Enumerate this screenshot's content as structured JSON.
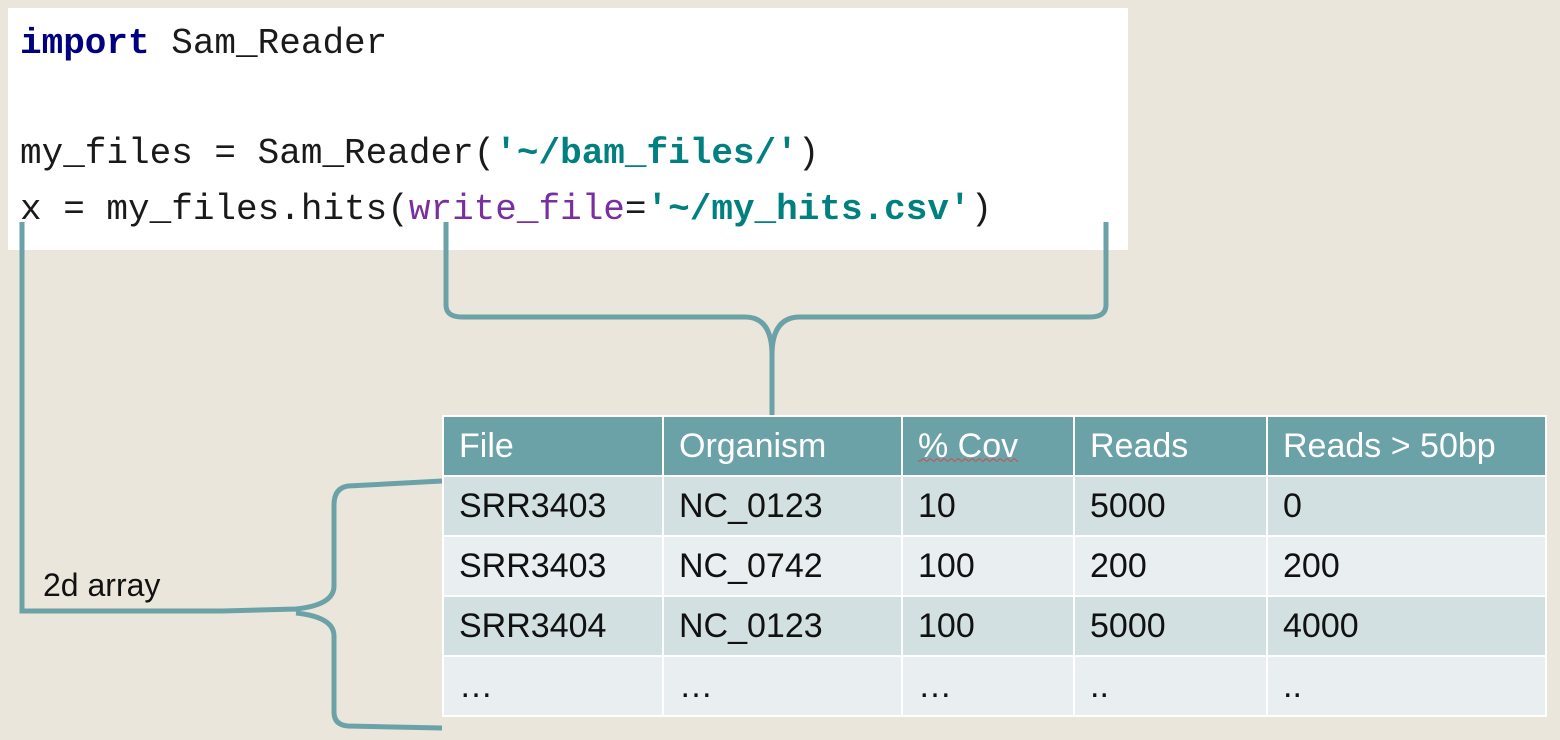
{
  "code": {
    "line1": {
      "keyword": "import",
      "rest": " Sam_Reader"
    },
    "line2": {
      "pre": "my_files = Sam_Reader(",
      "string": "'~/bam_files/'",
      "post": ")"
    },
    "line3": {
      "pre": "x = my_files.hits(",
      "param": "write_file",
      "eq": "=",
      "string": "'~/my_hits.csv'",
      "post": ")"
    }
  },
  "annotation": {
    "label": "2d array"
  },
  "table": {
    "headers": [
      "File",
      "Organism",
      "% Cov",
      "Reads",
      "Reads > 50bp"
    ],
    "rows": [
      [
        "SRR3403",
        "NC_0123",
        "10",
        "5000",
        "0"
      ],
      [
        "SRR3403",
        "NC_0742",
        "100",
        "200",
        "200"
      ],
      [
        "SRR3404",
        "NC_0123",
        "100",
        "5000",
        "4000"
      ],
      [
        "…",
        "…",
        "…",
        "..",
        ".."
      ]
    ]
  },
  "colors": {
    "accent": "#6ba2a8",
    "background": "#ebe6dc",
    "row_odd": "#d3e0e1",
    "row_even": "#e9eff0"
  }
}
